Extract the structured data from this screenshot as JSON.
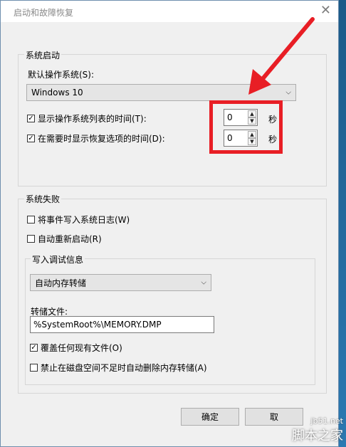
{
  "window": {
    "title": "启动和故障恢复",
    "close_glyph": "✕"
  },
  "system_startup": {
    "legend": "系统启动",
    "default_os_label": "默认操作系统(S):",
    "default_os_value": "Windows 10",
    "show_list_label": "显示操作系统列表的时间(T):",
    "show_list_checked": true,
    "show_list_value": "0",
    "show_recovery_label": "在需要时显示恢复选项的时间(D):",
    "show_recovery_checked": true,
    "show_recovery_value": "0",
    "seconds_unit": "秒"
  },
  "system_failure": {
    "legend": "系统失败",
    "write_event_label": "将事件写入系统日志(W)",
    "write_event_checked": false,
    "auto_restart_label": "自动重新启动(R)",
    "auto_restart_checked": false,
    "debug": {
      "legend": "写入调试信息",
      "dump_type_value": "自动内存转储",
      "dump_file_label": "转储文件:",
      "dump_file_value": "%SystemRoot%\\MEMORY.DMP",
      "overwrite_label": "覆盖任何现有文件(O)",
      "overwrite_checked": true,
      "disable_auto_delete_label": "禁止在磁盘空间不足时自动删除内存转储(A)",
      "disable_auto_delete_checked": false
    }
  },
  "buttons": {
    "ok": "确定",
    "cancel": "取"
  },
  "watermark": {
    "site": "jb51.net",
    "brand": "脚本之家"
  },
  "colors": {
    "highlight": "#e81e25",
    "desktop": "#1f5f8f"
  }
}
